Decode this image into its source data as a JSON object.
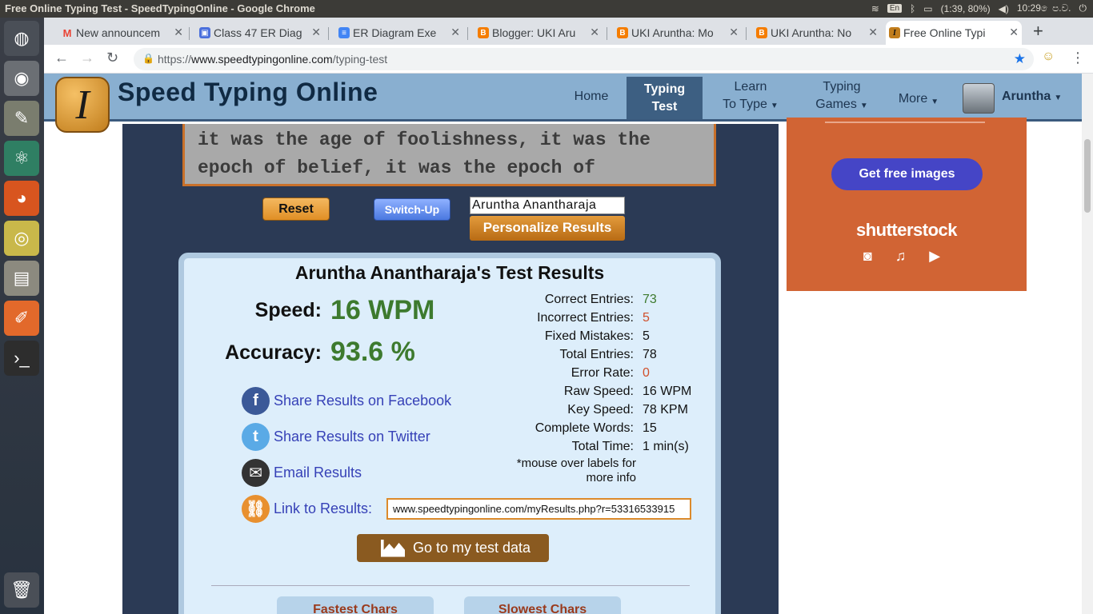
{
  "os": {
    "window_title": "Free Online Typing Test - SpeedTypingOnline - Google Chrome",
    "keyboard": "En",
    "battery": "(1:39, 80%)",
    "time": "10:29 ෙප.ව."
  },
  "tabs": [
    {
      "label": "New announcem",
      "icon": "gmail-icon",
      "color": "#ea4335",
      "glyph": "M"
    },
    {
      "label": "Class 47 ER Diag",
      "icon": "classroom-icon",
      "color": "#4a6fdc",
      "glyph": "▣"
    },
    {
      "label": "ER Diagram Exe",
      "icon": "docs-icon",
      "color": "#4285f4",
      "glyph": "≡"
    },
    {
      "label": "Blogger: UKI Aru",
      "icon": "blogger-icon",
      "color": "#f57d00",
      "glyph": "B"
    },
    {
      "label": "UKI Aruntha: Mo",
      "icon": "blogger-icon",
      "color": "#f57d00",
      "glyph": "B"
    },
    {
      "label": "UKI Aruntha: No",
      "icon": "blogger-icon",
      "color": "#f57d00",
      "glyph": "B"
    },
    {
      "label": "Free Online Typi",
      "icon": "speedtyping-icon",
      "color": "#c17d1c",
      "glyph": "I"
    }
  ],
  "address": {
    "scheme": "https://",
    "host": "www.speedtypingonline.com",
    "path": "/typing-test"
  },
  "site": {
    "logo_letter": "I",
    "name": "Speed Typing Online",
    "nav": {
      "home": "Home",
      "typing_test_1": "Typing",
      "typing_test_2": "Test",
      "learn_1": "Learn",
      "learn_2": "To Type",
      "games_1": "Typing",
      "games_2": "Games",
      "more": "More"
    },
    "user": "Aruntha"
  },
  "test": {
    "line1": "it was the age of foolishness, it was the",
    "line2": "epoch of belief, it was the epoch of",
    "reset": "Reset",
    "switch_up": "Switch-Up",
    "name_value": "Aruntha Anantharaja",
    "personalize": "Personalize Results"
  },
  "results": {
    "title": "Aruntha Anantharaja's Test Results",
    "speed_label": "Speed:",
    "speed_value": "16 WPM",
    "accuracy_label": "Accuracy:",
    "accuracy_value": "93.6 %",
    "stats": [
      {
        "label": "Correct Entries:",
        "value": "73",
        "tone": "green"
      },
      {
        "label": "Incorrect Entries:",
        "value": "5",
        "tone": "red"
      },
      {
        "label": "Fixed Mistakes:",
        "value": "5",
        "tone": ""
      },
      {
        "label": "Total Entries:",
        "value": "78",
        "tone": ""
      },
      {
        "label": "Error Rate:",
        "value": "0",
        "tone": "red"
      },
      {
        "label": "Raw Speed:",
        "value": "16 WPM",
        "tone": ""
      },
      {
        "label": "Key Speed:",
        "value": "78 KPM",
        "tone": ""
      },
      {
        "label": "Complete Words:",
        "value": "15",
        "tone": ""
      },
      {
        "label": "Total Time:",
        "value": "1 min(s)",
        "tone": ""
      }
    ],
    "note_1": "*mouse over labels for",
    "note_2": "more info",
    "share_facebook": "Share Results on Facebook",
    "share_twitter": "Share Results on Twitter",
    "email": "Email Results",
    "link_label": "Link to Results:",
    "link_url": "www.speedtypingonline.com/myResults.php?r=53316533915",
    "test_data": "Go to my test data",
    "fastest": "Fastest Chars",
    "slowest": "Slowest Chars"
  },
  "ad": {
    "button": "Get free images",
    "brand": "shutterstock",
    "icons": "◙ ♫ ▶"
  },
  "colors": {
    "accent_green": "#3d7a2e",
    "accent_red": "#d04f2a",
    "link_blue": "#3641b7",
    "nav_bg": "#89afd0"
  }
}
